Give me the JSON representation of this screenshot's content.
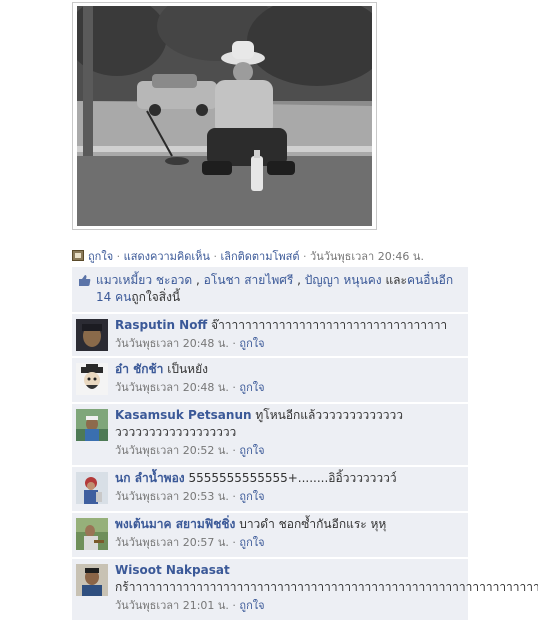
{
  "post": {
    "photo_alt": "",
    "actions": {
      "like": "ถูกใจ",
      "comment": "แสดงความคิดเห็น",
      "unfollow": "เลิกติดตามโพสต์",
      "timestamp": "วันวันพุธเวลา 20:46 น."
    }
  },
  "likes": {
    "names": [
      "แมวเหมี้ยว ชะอวด",
      "อโนชา สายไพศรี",
      "ปัญญา หนุนคง"
    ],
    "sep1": " , ",
    "sep2": " , ",
    "and_text": "และ",
    "others": "คนอื่นอีก 14 คน",
    "suffix": "ถูกใจสิ่งนี้"
  },
  "comments": [
    {
      "name": "Rasputin Noff",
      "text": "จ๊าาาาาาาาาาาาาาาาาาาาาาาาาาาาาาาาาา",
      "time": "วันวันพุธเวลา 20:48 น.",
      "like": "ถูกใจ"
    },
    {
      "name": "อ๋า ชักช้า",
      "text": "เป็นหยัง",
      "time": "วันวันพุธเวลา 20:48 น.",
      "like": "ถูกใจ"
    },
    {
      "name": "Kasamsuk Petsanun",
      "text": "ทูโหนอีกแล้ววววววววววววว วววววววววววววววววว",
      "time": "วันวันพุธเวลา 20:52 น.",
      "like": "ถูกใจ"
    },
    {
      "name": "นก ลำน้ำพอง",
      "text": "5555555555555+........อิอิ้วววววววว์",
      "time": "วันวันพุธเวลา 20:53 น.",
      "like": "ถูกใจ"
    },
    {
      "name": "พงเต้นมาค สยามฟิชชิ่ง",
      "text": "บาวดำ ชอกซ้ำกันอีกแระ หุหุ",
      "time": "วันวันพุธเวลา 20:57 น.",
      "like": "ถูกใจ"
    },
    {
      "name": "Wisoot Nakpasat",
      "text": "กร้าาาาาาาาาาาาาาาาาาาาาาาาาาาาาาาาาาาาาาาาาาาาาาาาาาาาาาาาาาาาาาาา",
      "time": "วันวันพุธเวลา 21:01 น.",
      "like": "ถูกใจ"
    }
  ],
  "colors": {
    "link": "#3b5998",
    "ufi_bg": "#edeff4",
    "meta": "#777777"
  }
}
